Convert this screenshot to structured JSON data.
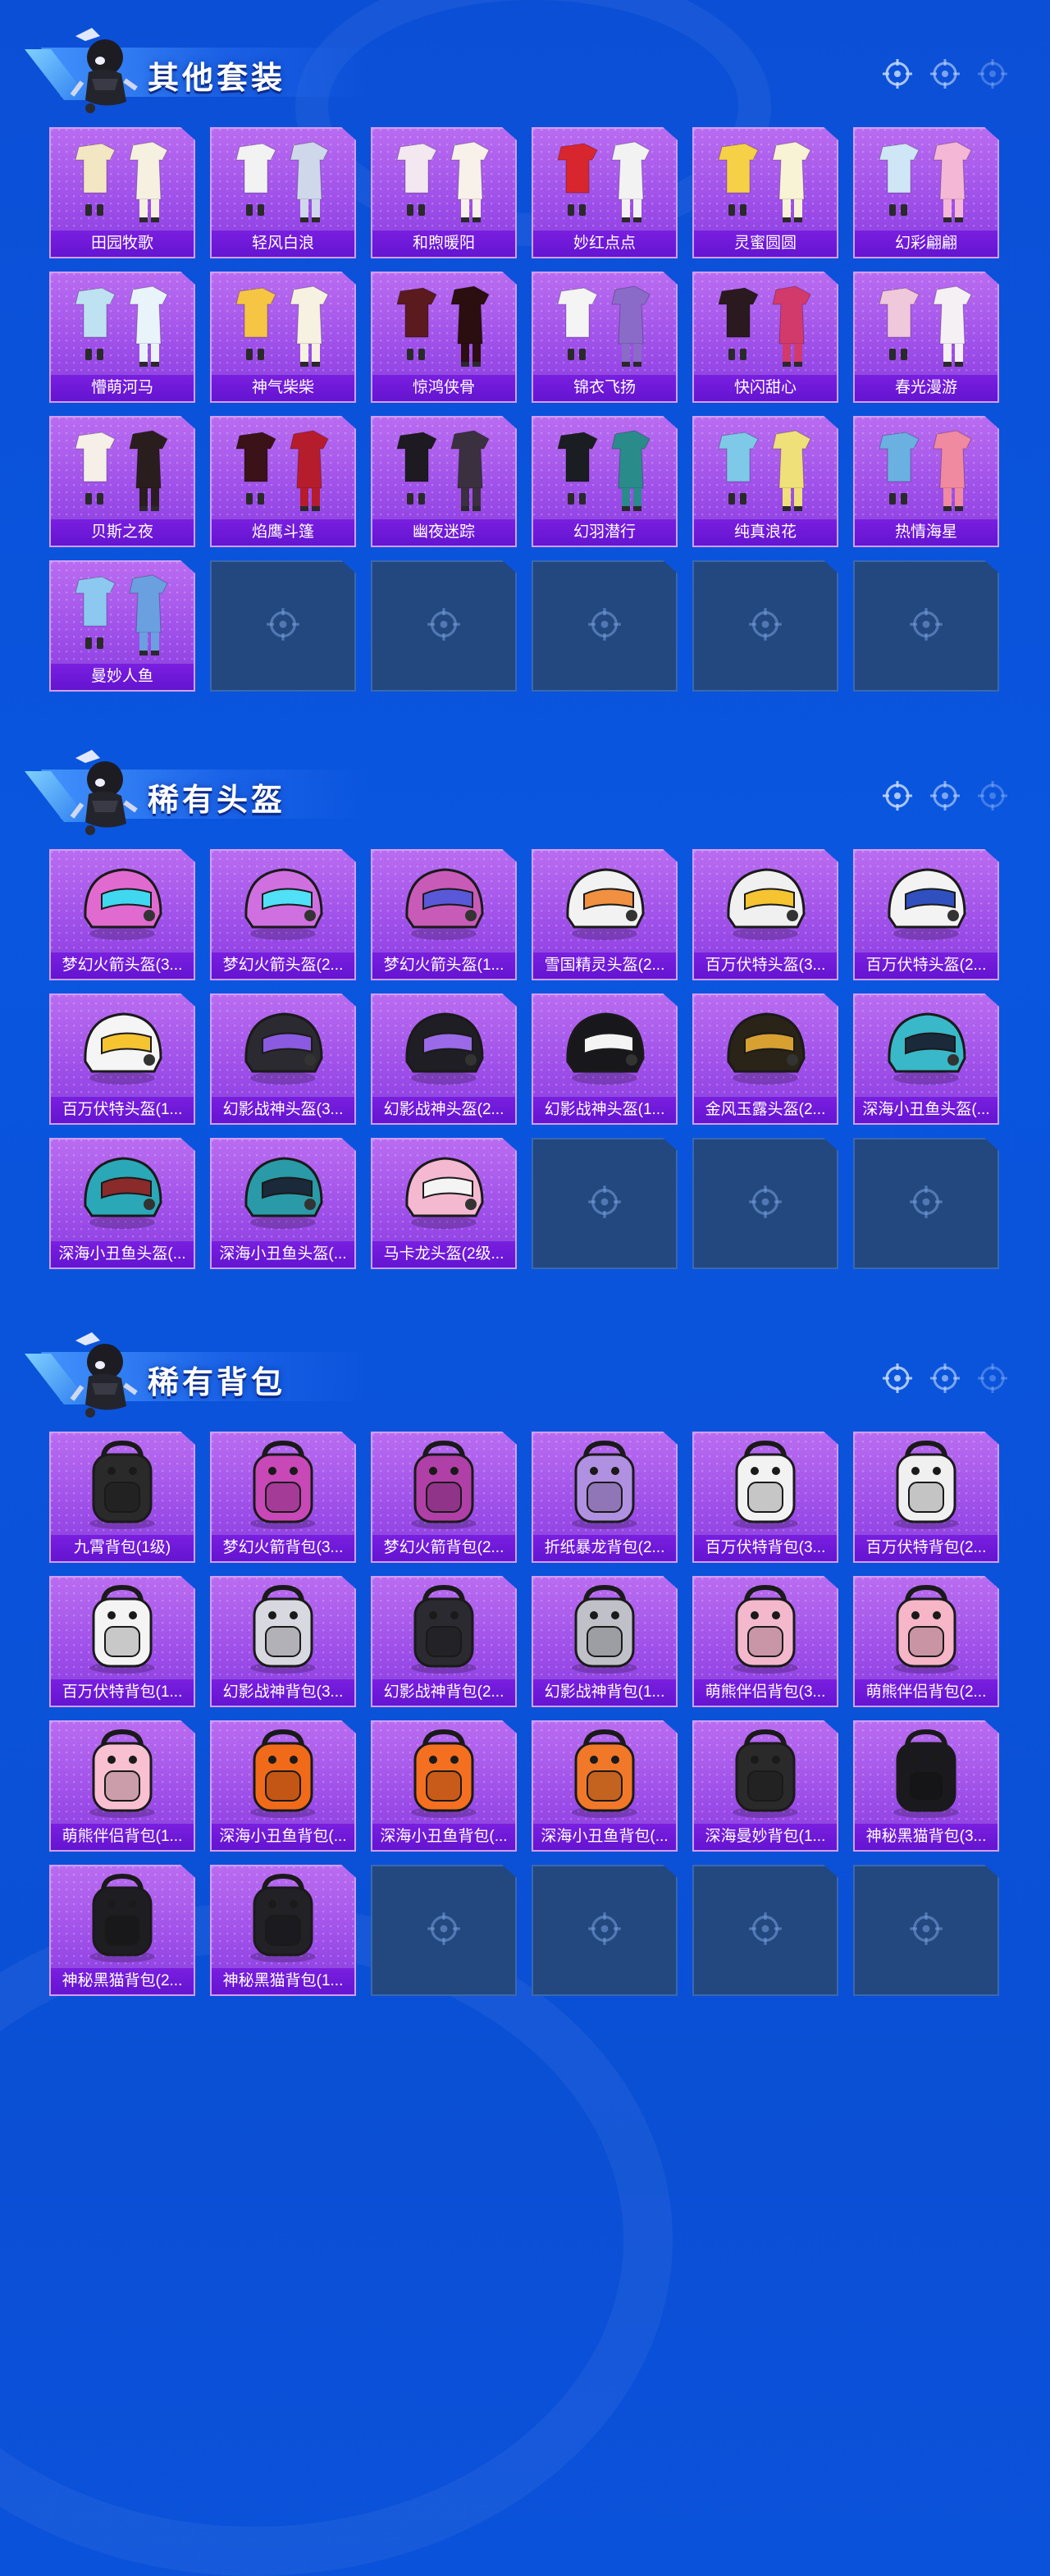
{
  "colors": {
    "background": "#0b4fd6",
    "card": "#a557ec",
    "card_label": "#6a18d6",
    "empty_slot": "#23487f"
  },
  "sections": [
    {
      "title": "其他套装",
      "icon": "outfit",
      "items": [
        "田园牧歌",
        "轻风白浪",
        "和煦暖阳",
        "妙红点点",
        "灵蜜圆圆",
        "幻彩翩翩",
        "懵萌河马",
        "神气柴柴",
        "惊鸿侠骨",
        "锦衣飞扬",
        "快闪甜心",
        "春光漫游",
        "贝斯之夜",
        "焰鹰斗篷",
        "幽夜迷踪",
        "幻羽潜行",
        "纯真浪花",
        "热情海星",
        "曼妙人鱼"
      ],
      "empty_slots": 5
    },
    {
      "title": "稀有头盔",
      "icon": "helmet",
      "items": [
        "梦幻火箭头盔(3...",
        "梦幻火箭头盔(2...",
        "梦幻火箭头盔(1...",
        "雪国精灵头盔(2...",
        "百万伏特头盔(3...",
        "百万伏特头盔(2...",
        "百万伏特头盔(1...",
        "幻影战神头盔(3...",
        "幻影战神头盔(2...",
        "幻影战神头盔(1...",
        "金风玉露头盔(2...",
        "深海小丑鱼头盔(...",
        "深海小丑鱼头盔(...",
        "深海小丑鱼头盔(...",
        "马卡龙头盔(2级..."
      ],
      "empty_slots": 3
    },
    {
      "title": "稀有背包",
      "icon": "backpack",
      "items": [
        "九霄背包(1级)",
        "梦幻火箭背包(3...",
        "梦幻火箭背包(2...",
        "折纸暴龙背包(2...",
        "百万伏特背包(3...",
        "百万伏特背包(2...",
        "百万伏特背包(1...",
        "幻影战神背包(3...",
        "幻影战神背包(2...",
        "幻影战神背包(1...",
        "萌熊伴侣背包(3...",
        "萌熊伴侣背包(2...",
        "萌熊伴侣背包(1...",
        "深海小丑鱼背包(...",
        "深海小丑鱼背包(...",
        "深海小丑鱼背包(...",
        "深海曼妙背包(1...",
        "神秘黑猫背包(3...",
        "神秘黑猫背包(2...",
        "神秘黑猫背包(1..."
      ],
      "empty_slots": 4
    }
  ]
}
